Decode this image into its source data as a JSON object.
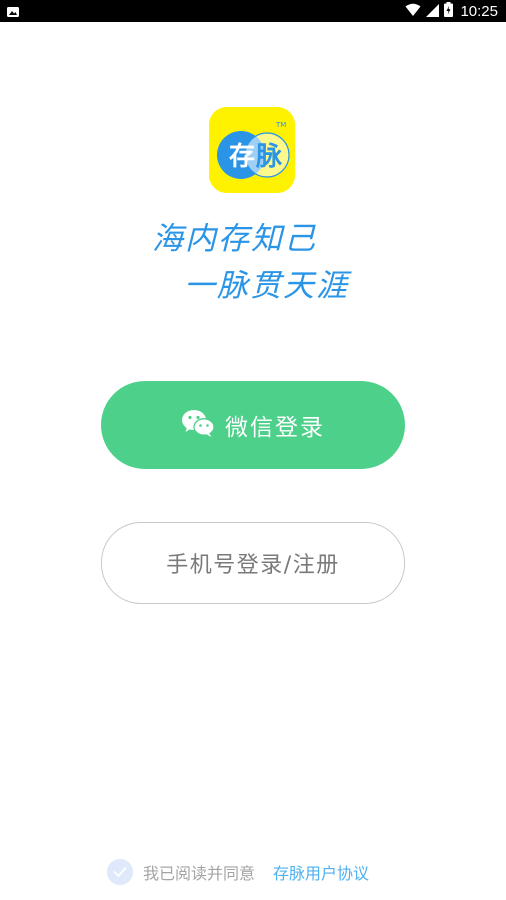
{
  "status_bar": {
    "time": "10:25"
  },
  "logo": {
    "text_left": "存",
    "text_right": "脉",
    "tm": "TM",
    "colors": {
      "background": "#fff200",
      "circle_blue": "#2a95e6"
    }
  },
  "slogan": {
    "line1": "海内存知己",
    "line2": "一脉贯天涯",
    "color": "#2a95e6"
  },
  "wechat_login": {
    "label": "微信登录",
    "icon": "wechat-icon",
    "color": "#4cd08a"
  },
  "phone_login": {
    "label": "手机号登录/注册"
  },
  "agreement": {
    "text": "我已阅读并同意",
    "link": "存脉用户协议",
    "checked": true,
    "link_color": "#4fb0f0"
  }
}
